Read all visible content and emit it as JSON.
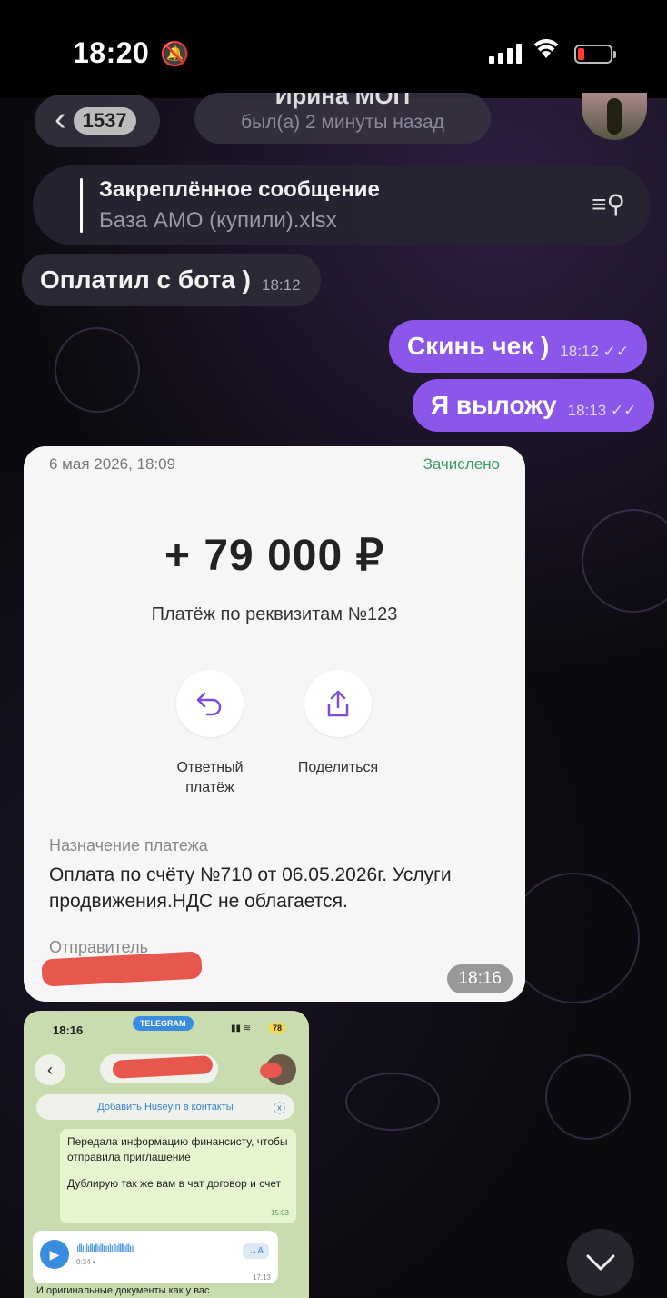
{
  "status_bar": {
    "time": "18:20",
    "battery_level": 0.15
  },
  "header": {
    "back_count": "1537",
    "contact_name": "Ирина МОП",
    "last_seen": "был(а) 2 минуты назад"
  },
  "pinned": {
    "title": "Закреплённое сообщение",
    "text": "База АМО (купили).xlsx"
  },
  "messages": [
    {
      "text": "Оплатил с бота )",
      "time": "18:12",
      "direction": "incoming"
    },
    {
      "text": "Скинь чек )",
      "time": "18:12",
      "direction": "outgoing",
      "status": "✓✓"
    },
    {
      "text": "Я выложу",
      "time": "18:13",
      "direction": "outgoing",
      "status": "✓✓"
    }
  ],
  "receipt": {
    "date": "6 мая 2026, 18:09",
    "status": "Зачислено",
    "amount": "+ 79 000 ₽",
    "purpose_title": "Платёж по реквизитам №123",
    "actions": [
      {
        "label": "Ответный\nплатёж",
        "icon": "reply-icon"
      },
      {
        "label": "Поделиться",
        "icon": "share-icon"
      }
    ],
    "section_title": "Назначение платежа",
    "section_text": "Оплата по счёту №710 от 06.05.2026г. Услуги продвижения.НДС не облагается.",
    "sender_label": "Отправитель",
    "time": "18:16"
  },
  "screenshot": {
    "time": "18:16",
    "telegram_badge": "TELEGRAM",
    "battery": "78",
    "add_contact": "Добавить Huseyin в контакты",
    "message_line1": "Передала информацию финансисту, чтобы отправила приглашение",
    "message_line2": "Дублирую так же вам в чат договор и счет",
    "message_time": "15:03",
    "voice_duration": "0:34 •",
    "voice_transcribe": "→A",
    "voice_time": "17:13",
    "tail_text": "И оригинальные документы как у вас"
  },
  "colors": {
    "outgoing_bubble": "#8a57ea",
    "status_green": "#3a9b6a",
    "accent_blue": "#3a8cde"
  }
}
